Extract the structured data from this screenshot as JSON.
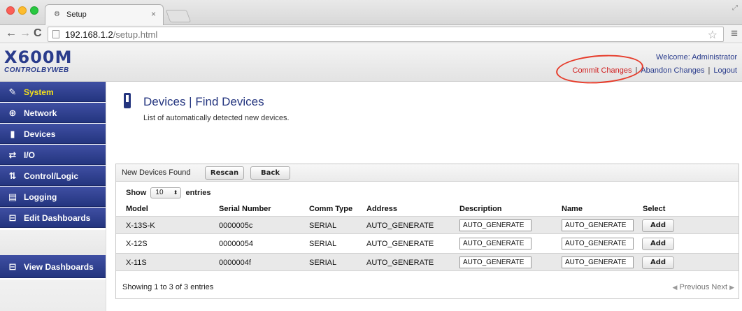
{
  "browser": {
    "tab_title": "Setup",
    "tab_close": "×",
    "url_host": "192.168.1.2",
    "url_path": "/setup.html",
    "nav_back": "←",
    "nav_forward": "→",
    "nav_reload": "C",
    "star": "☆",
    "menu": "≡"
  },
  "header": {
    "logo_model": "X600M",
    "logo_brand": "CONTROLBYWEB",
    "welcome": "Welcome: Administrator",
    "links": {
      "commit": "Commit Changes",
      "abandon": "Abandon Changes",
      "logout": "Logout",
      "separator": "|"
    },
    "colors": {
      "brand": "#2a3c8c",
      "commit_link": "#d02020",
      "annotation": "#e63b2a"
    }
  },
  "sidebar": {
    "items": [
      {
        "label": "System",
        "icon": "wrench-icon",
        "active": true
      },
      {
        "label": "Network",
        "icon": "globe-icon"
      },
      {
        "label": "Devices",
        "icon": "device-icon"
      },
      {
        "label": "I/O",
        "icon": "arrows-icon"
      },
      {
        "label": "Control/Logic",
        "icon": "logic-icon"
      },
      {
        "label": "Logging",
        "icon": "log-icon"
      },
      {
        "label": "Edit Dashboards",
        "icon": "dashboard-icon"
      },
      {
        "label": "View Dashboards",
        "icon": "dashboard-icon"
      }
    ],
    "colors": {
      "item_bg": "#24357f",
      "active_label": "#f5e11a"
    }
  },
  "page": {
    "title": "Devices | Find Devices",
    "subtitle": "List of automatically detected new devices."
  },
  "panel": {
    "title": "New Devices Found",
    "rescan_label": "Rescan",
    "back_label": "Back",
    "show_label": "Show",
    "show_value": "10",
    "entries_label": "entries",
    "columns": {
      "model": "Model",
      "serial": "Serial Number",
      "comm": "Comm Type",
      "address": "Address",
      "description": "Description",
      "name": "Name",
      "select": "Select"
    },
    "rows": [
      {
        "model": "X-13S-K",
        "serial": "0000005c",
        "comm": "SERIAL",
        "address": "AUTO_GENERATE",
        "description": "AUTO_GENERATE",
        "name": "AUTO_GENERATE",
        "action": "Add"
      },
      {
        "model": "X-12S",
        "serial": "00000054",
        "comm": "SERIAL",
        "address": "AUTO_GENERATE",
        "description": "AUTO_GENERATE",
        "name": "AUTO_GENERATE",
        "action": "Add"
      },
      {
        "model": "X-11S",
        "serial": "0000004f",
        "comm": "SERIAL",
        "address": "AUTO_GENERATE",
        "description": "AUTO_GENERATE",
        "name": "AUTO_GENERATE",
        "action": "Add"
      }
    ],
    "info": "Showing 1 to 3 of 3 entries",
    "previous": "Previous",
    "next": "Next"
  }
}
